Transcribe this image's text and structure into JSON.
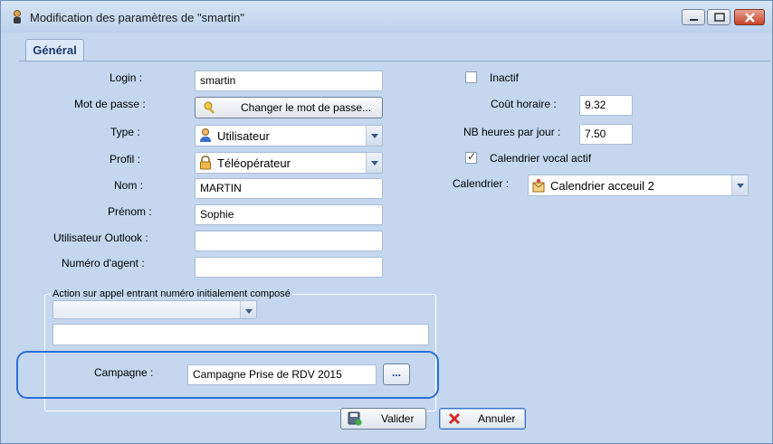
{
  "window": {
    "title": "Modification des paramètres de \"smartin\""
  },
  "tabs": [
    {
      "label": "Général"
    }
  ],
  "form": {
    "login_label": "Login :",
    "login_value": "smartin",
    "password_label": "Mot de passe :",
    "password_button": "Changer le mot de passe...",
    "type_label": "Type :",
    "type_value": "Utilisateur",
    "profil_label": "Profil :",
    "profil_value": "Téléopérateur",
    "nom_label": "Nom :",
    "nom_value": "MARTIN",
    "prenom_label": "Prénom :",
    "prenom_value": "Sophie",
    "outlook_label": "Utilisateur Outlook :",
    "outlook_value": "",
    "agent_label": "Numéro d'agent :",
    "agent_value": ""
  },
  "right": {
    "inactif_label": "Inactif",
    "inactif_checked": false,
    "cout_label": "Coût horaire :",
    "cout_value": "9.32",
    "heures_label": "NB heures par jour :",
    "heures_value": "7.50",
    "calendrier_vocal_label": "Calendrier vocal actif",
    "calendrier_vocal_checked": true,
    "calendrier_label": "Calendrier :",
    "calendrier_value": "Calendrier acceuil 2"
  },
  "action_group": {
    "title": "Action sur appel entrant numéro initialement composé",
    "select_value": "",
    "text_value": ""
  },
  "campagne": {
    "label": "Campagne :",
    "value": "Campagne Prise de RDV 2015",
    "browse_label": "..."
  },
  "footer": {
    "validate_label": "Valider",
    "cancel_label": "Annuler"
  },
  "colors": {
    "window_bg": "#c4d7ef",
    "highlight": "#2a6fd6",
    "close_button": "#c8442a"
  }
}
